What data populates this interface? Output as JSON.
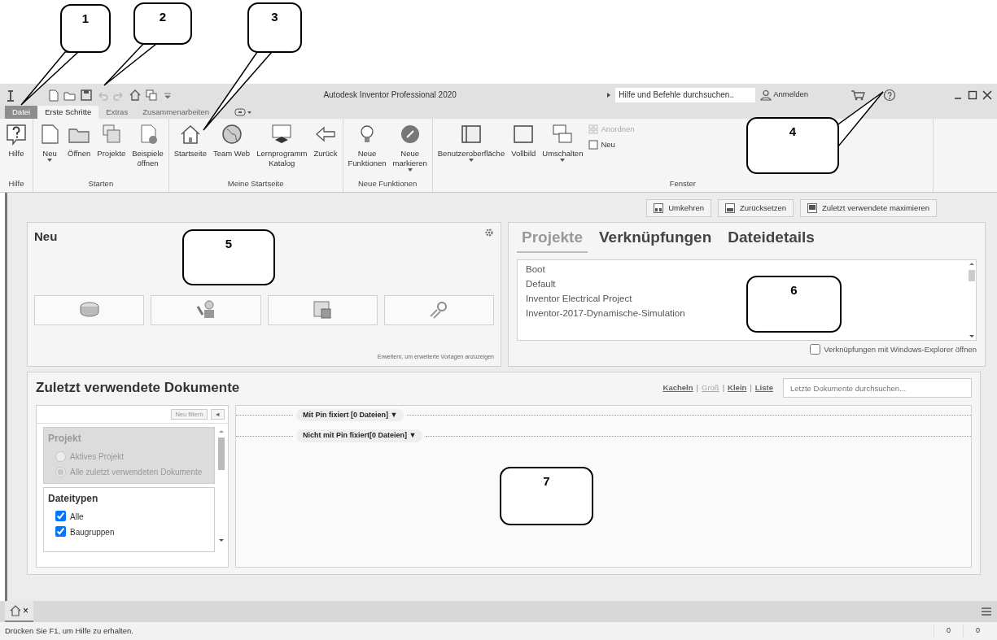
{
  "callouts": [
    {
      "number": "1"
    },
    {
      "number": "2"
    },
    {
      "number": "3"
    },
    {
      "number": "4"
    },
    {
      "number": "5"
    },
    {
      "number": "6"
    },
    {
      "number": "7"
    }
  ],
  "window": {
    "title": "Autodesk Inventor Professional 2020",
    "search": {
      "placeholder": "Hilfe und Befehle durchsuchen.."
    },
    "sign_in": "Anmelden"
  },
  "tabs": [
    {
      "label": "Datei",
      "kind": "file",
      "selected": false
    },
    {
      "label": "Erste Schritte",
      "kind": "tab",
      "selected": true
    },
    {
      "label": "Extras",
      "kind": "tab",
      "selected": false
    },
    {
      "label": "Zusammenarbeiten",
      "kind": "tab",
      "selected": false
    }
  ],
  "ribbon": {
    "panels": [
      {
        "title": "Hilfe",
        "buttons": [
          {
            "label": "Hilfe",
            "dropdown": false
          }
        ]
      },
      {
        "title": "Starten",
        "buttons": [
          {
            "label": "Neu",
            "dropdown": true
          },
          {
            "label": "Öffnen",
            "dropdown": false
          },
          {
            "label": "Projekte",
            "dropdown": false
          },
          {
            "label": "Beispiele\nöffnen",
            "dropdown": false
          }
        ]
      },
      {
        "title": "Meine Startseite",
        "buttons": [
          {
            "label": "Startseite",
            "dropdown": false
          },
          {
            "label": "Team Web",
            "dropdown": false
          },
          {
            "label": "Lernprogramm\nKatalog",
            "dropdown": false
          },
          {
            "label": "Zurück",
            "dropdown": false
          }
        ]
      },
      {
        "title": "Neue Funktionen",
        "buttons": [
          {
            "label": "Neue\nFunktionen",
            "dropdown": false
          },
          {
            "label": "Neue\nmarkieren",
            "dropdown": true
          }
        ]
      },
      {
        "title": "Fenster",
        "buttons": [
          {
            "label": "Benutzeroberfläche",
            "dropdown": true
          },
          {
            "label": "Vollbild",
            "dropdown": false
          },
          {
            "label": "Umschalten",
            "dropdown": true
          }
        ],
        "small_buttons": [
          {
            "label": "Anordnen",
            "disabled": true
          },
          {
            "label": "Neu",
            "disabled": false
          }
        ]
      }
    ]
  },
  "layout_buttons": [
    {
      "label": "Umkehren"
    },
    {
      "label": "Zurücksetzen"
    },
    {
      "label": "Zuletzt verwendete maximieren"
    }
  ],
  "new_panel": {
    "title": "Neu",
    "hint": "Erweitern, um erweiterte Vorlagen anzuzeigen"
  },
  "projects_panel": {
    "tabs": [
      {
        "label": "Projekte",
        "selected": true
      },
      {
        "label": "Verknüpfungen",
        "selected": false
      },
      {
        "label": "Dateidetails",
        "selected": false
      }
    ],
    "items": [
      {
        "label": "Boot"
      },
      {
        "label": "Default"
      },
      {
        "label": "Inventor Electrical Project"
      },
      {
        "label": "Inventor-2017-Dynamische-Simulation"
      }
    ],
    "open_in_explorer": {
      "label": "Verknüpfungen mit Windows-Explorer öffnen",
      "checked": false
    }
  },
  "recent": {
    "title": "Zuletzt verwendete Dokumente",
    "views": [
      {
        "label": "Kacheln",
        "selected": false
      },
      {
        "label": "Groß",
        "selected": true
      },
      {
        "label": "Klein",
        "selected": false
      },
      {
        "label": "Liste",
        "selected": false
      }
    ],
    "separators": [
      "|",
      "|",
      "|"
    ],
    "search": {
      "placeholder": "Letzte Dokumente durchsuchen..."
    },
    "filter": {
      "refilter": "Neu filtern",
      "collapse": "◄",
      "project": {
        "title": "Projekt",
        "disabled": true,
        "options": [
          {
            "label": "Aktives Projekt",
            "selected": false
          },
          {
            "label": "Alle zuletzt verwendeten Dokumente",
            "selected": true
          }
        ]
      },
      "file_types": {
        "title": "Dateitypen",
        "options": [
          {
            "label": "Alle",
            "checked": true
          },
          {
            "label": "Baugruppen",
            "checked": true
          }
        ]
      }
    },
    "groups": [
      {
        "label": "Mit Pin fixiert [0 Dateien] ▼"
      },
      {
        "label": "Nicht mit Pin fixiert[0 Dateien] ▼"
      }
    ]
  },
  "doc_tab": {
    "close": "×"
  },
  "status_bar": {
    "message": "Drücken Sie F1, um Hilfe zu erhalten.",
    "fields": [
      "0",
      "0"
    ]
  }
}
